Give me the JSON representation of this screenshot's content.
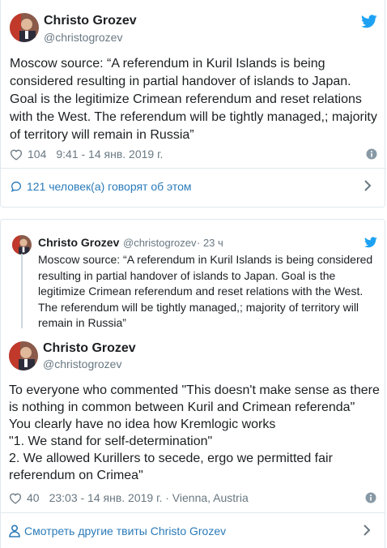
{
  "colors": {
    "link": "#2b7bb9",
    "twitter_blue": "#1da1f2",
    "muted": "#697882",
    "text": "#1c2022",
    "border": "#e1e8ed"
  },
  "tweet1": {
    "author_name": "Christo Grozev",
    "author_handle": "@christogrozev",
    "text": "Moscow source: “A referendum in Kuril Islands is being considered resulting in partial handover of islands to Japan. Goal is the legitimize Crimean referendum and reset relations with the West. The referendum will be tightly managed,; majority of territory will remain in Russia”",
    "likes": "104",
    "timestamp": "9:41 - 14 янв. 2019 г.",
    "talking": "121 человек(а) говорят об этом"
  },
  "quoted": {
    "author_name": "Christo Grozev",
    "author_handle": "@christogrozev",
    "time_ago": "· 23 ч",
    "text": "Moscow source: “A referendum in Kuril Islands is being considered resulting in partial handover of islands to Japan. Goal is the legitimize Crimean referendum and reset relations with the West. The referendum will be tightly managed,; majority of territory will remain in Russia”"
  },
  "tweet2": {
    "author_name": "Christo Grozev",
    "author_handle": "@christogrozev",
    "text": "To everyone who commented \"This doesn't make sense as there is nothing in common between Kuril and Crimean referenda\"\nYou clearly have no idea how Kremlogic works\n\"1. We stand for self-determination\"\n2. We allowed Kurillers to secede,  ergo we permitted fair referendum on Crimea\"",
    "likes": "40",
    "timestamp": "23:03 - 14 янв. 2019 г. · Vienna, Austria",
    "more_tweets": "Смотреть другие твиты Christo Grozev"
  },
  "icons": [
    "twitter-bird-icon",
    "heart-icon",
    "info-icon",
    "speech-bubble-icon",
    "chevron-right-icon",
    "person-icon"
  ]
}
